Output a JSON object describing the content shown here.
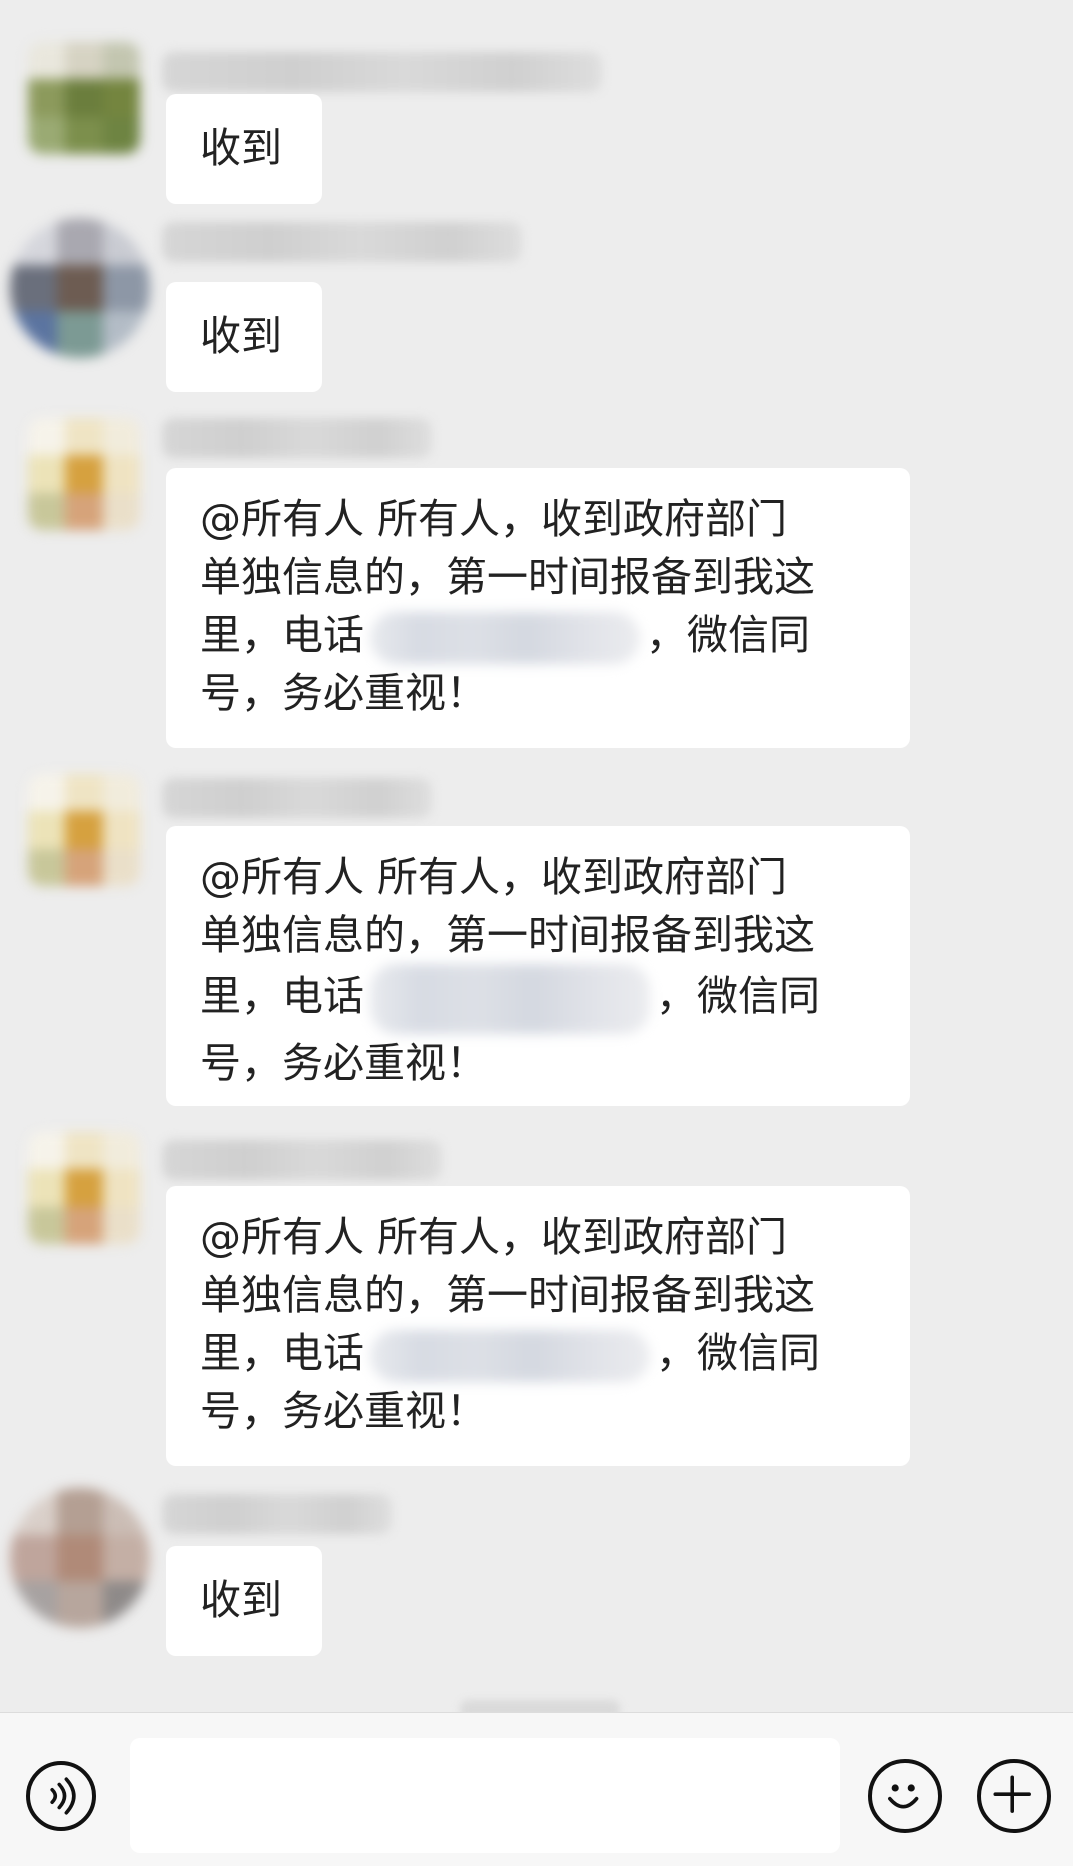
{
  "messages": [
    {
      "text": "收到"
    },
    {
      "text": "收到"
    },
    {
      "lines": [
        "@所有人  所有人，收到政府部门",
        "单独信息的，第一时间报备到我这",
        "里，电话",
        "，微信同",
        "号，务必重视！"
      ]
    },
    {
      "lines": [
        "@所有人  所有人，收到政府部门",
        "单独信息的，第一时间报备到我这",
        "里，电话",
        "，微信同",
        "号，务必重视！"
      ]
    },
    {
      "lines": [
        "@所有人  所有人，收到政府部门",
        "单独信息的，第一时间报备到我这",
        "里，电话",
        "，微信同",
        "号，务必重视！"
      ]
    },
    {
      "text": "收到"
    }
  ],
  "icons": {
    "voice": "voice-icon",
    "emoji": "emoji-icon",
    "plus": "plus-icon"
  },
  "colors": {
    "background": "#ededed",
    "bubble": "#ffffff",
    "input_bar": "#f7f7f7"
  }
}
